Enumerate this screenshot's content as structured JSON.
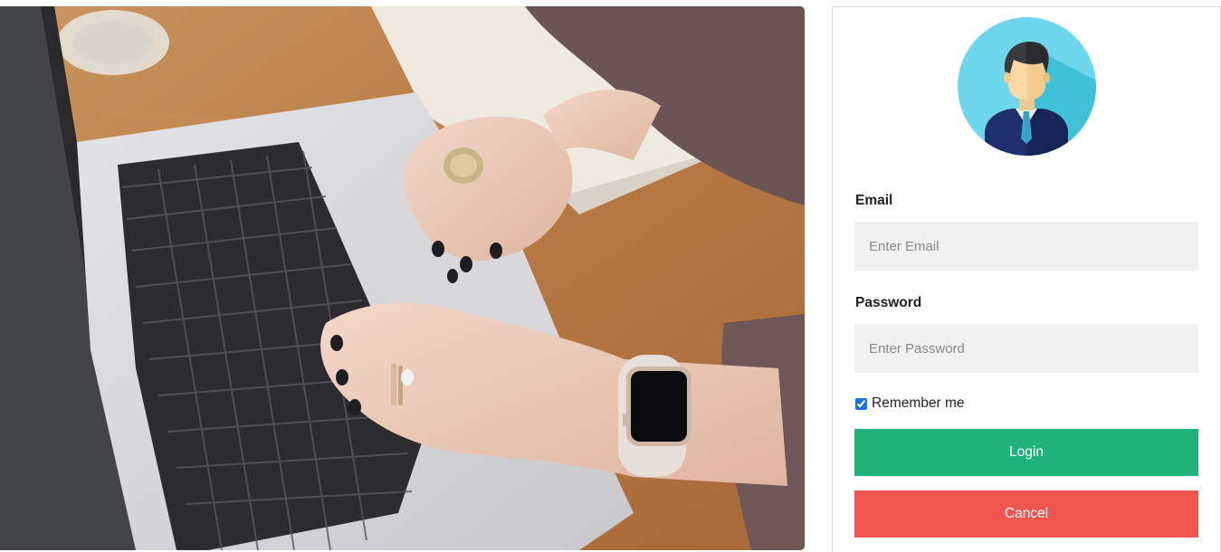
{
  "login": {
    "email_label": "Email",
    "email_placeholder": "Enter Email",
    "email_value": "",
    "password_label": "Password",
    "password_placeholder": "Enter Password",
    "password_value": "",
    "remember_label": "Remember me",
    "remember_checked": true,
    "login_label": "Login",
    "cancel_label": "Cancel"
  },
  "icons": {
    "avatar": "user-avatar-icon",
    "photo": "laptop-typing-photo"
  },
  "colors": {
    "login_button": "#1fb37b",
    "cancel_button": "#f0554e",
    "input_background": "#f1f1f1",
    "avatar_background": "#6fd7ec"
  }
}
